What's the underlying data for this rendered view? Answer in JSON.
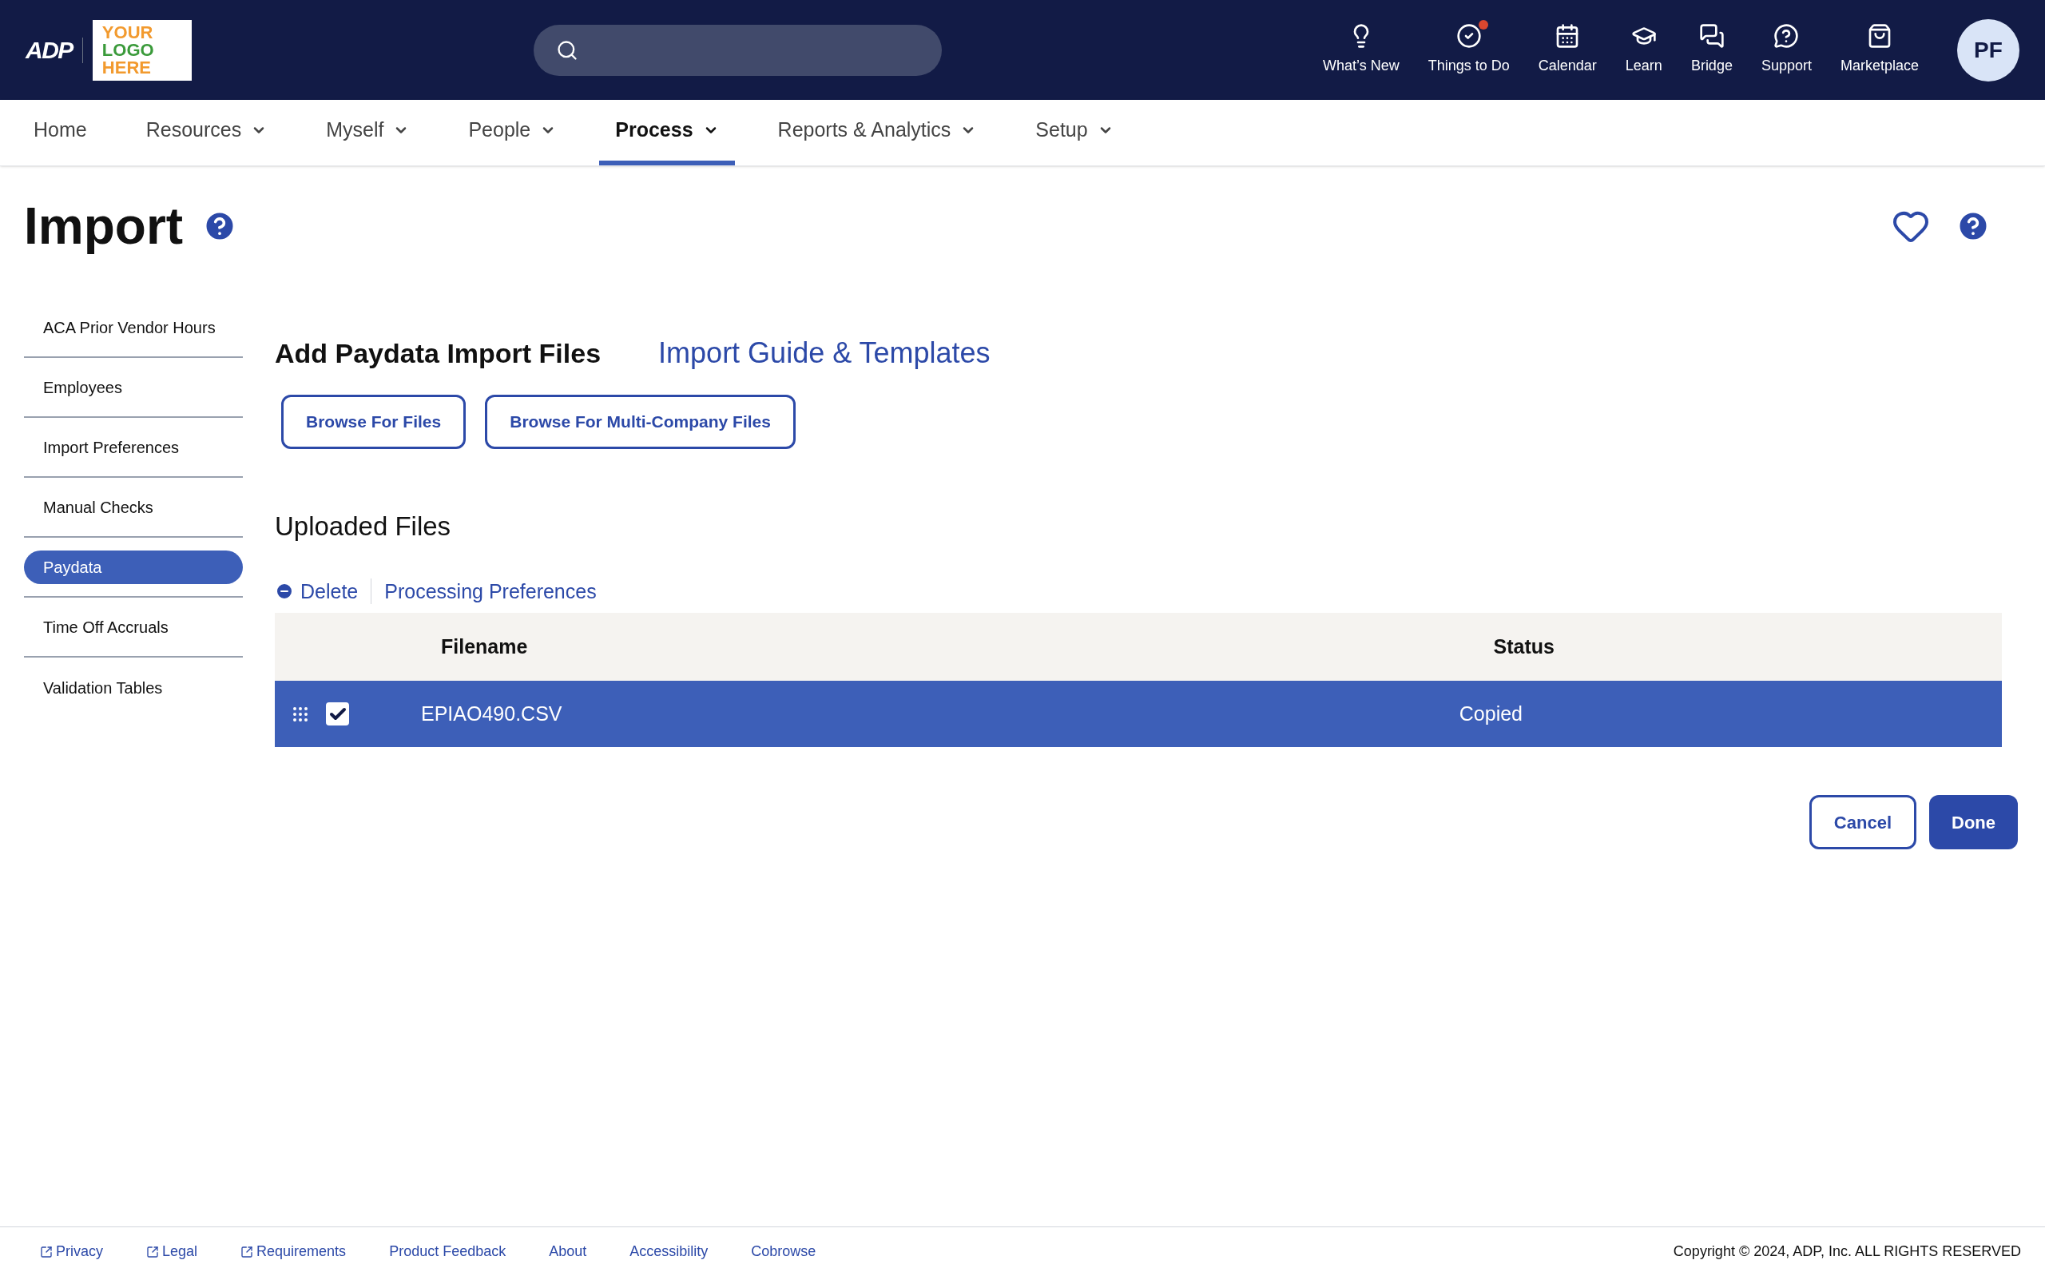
{
  "header": {
    "brand": "ADP",
    "logo_lines": [
      "YOUR",
      "LOGO",
      "HERE"
    ],
    "tools": [
      {
        "kind": "bulb",
        "label": "What’s New",
        "notification": false
      },
      {
        "kind": "check",
        "label": "Things to Do",
        "notification": true
      },
      {
        "kind": "calendar",
        "label": "Calendar",
        "notification": false
      },
      {
        "kind": "cap",
        "label": "Learn",
        "notification": false
      },
      {
        "kind": "bridge",
        "label": "Bridge",
        "notification": false
      },
      {
        "kind": "support",
        "label": "Support",
        "notification": false
      },
      {
        "kind": "bag",
        "label": "Marketplace",
        "notification": false
      }
    ],
    "avatar": "PF"
  },
  "nav": [
    {
      "label": "Home",
      "menu": false,
      "selected": false
    },
    {
      "label": "Resources",
      "menu": true,
      "selected": false
    },
    {
      "label": "Myself",
      "menu": true,
      "selected": false
    },
    {
      "label": "People",
      "menu": true,
      "selected": false
    },
    {
      "label": "Process",
      "menu": true,
      "selected": true
    },
    {
      "label": "Reports & Analytics",
      "menu": true,
      "selected": false
    },
    {
      "label": "Setup",
      "menu": true,
      "selected": false
    }
  ],
  "page_title": "Import",
  "sidebar": {
    "items": [
      {
        "label": "ACA Prior Vendor Hours",
        "selected": false
      },
      {
        "label": "Employees",
        "selected": false
      },
      {
        "label": "Import Preferences",
        "selected": false
      },
      {
        "label": "Manual Checks",
        "selected": false
      },
      {
        "label": "Paydata",
        "selected": true
      },
      {
        "label": "Time Off Accruals",
        "selected": false
      },
      {
        "label": "Validation Tables",
        "selected": false
      }
    ]
  },
  "add_section": {
    "title": "Add Paydata Import Files",
    "guide_link": "Import Guide & Templates",
    "buttons": [
      "Browse For Files",
      "Browse For Multi-Company Files"
    ]
  },
  "uploaded": {
    "title": "Uploaded Files",
    "actions": {
      "delete": "Delete",
      "preferences": "Processing Preferences"
    },
    "table": {
      "columns": [
        "Filename",
        "Status"
      ],
      "rows": [
        {
          "filename": "EPIAO490.CSV",
          "status": "Copied",
          "checked": true,
          "selected": true
        }
      ]
    }
  },
  "buttons": {
    "cancel": "Cancel",
    "done": "Done"
  },
  "footer": {
    "links": [
      {
        "label": "Privacy",
        "external": true
      },
      {
        "label": "Legal",
        "external": true
      },
      {
        "label": "Requirements",
        "external": true
      },
      {
        "label": "Product Feedback",
        "external": false
      },
      {
        "label": "About",
        "external": false
      },
      {
        "label": "Accessibility",
        "external": false
      },
      {
        "label": "Cobrowse",
        "external": false
      }
    ],
    "copyright": "Copyright © 2024, ADP, Inc. ALL RIGHTS RESERVED"
  }
}
